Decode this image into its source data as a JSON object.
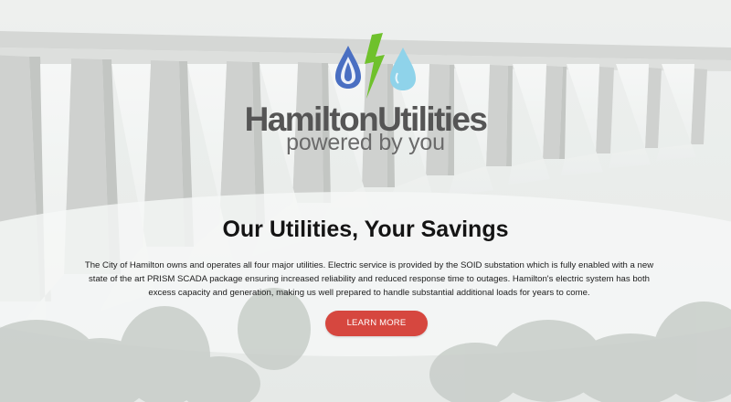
{
  "colors": {
    "water_drop_dark": "#4a6fc2",
    "bolt": "#6fc12c",
    "water_drop_light": "#8fd3ea",
    "logo_text": "#555555",
    "cta_background": "#d6473f",
    "cta_text": "#ffffff",
    "headline": "#141414"
  },
  "logo": {
    "name": "HamiltonUtilities",
    "tagline": "powered by you",
    "icons": [
      "water-drop-icon",
      "lightning-bolt-icon",
      "water-drop-icon"
    ]
  },
  "hero": {
    "background": "dam-spillway-photo",
    "headline": "Our Utilities, Your Savings",
    "paragraph": "The City of Hamilton owns and operates all four major utilities. Electric service is provided by the SOID substation which is fully enabled with a new state of the art PRISM SCADA package ensuring increased reliability and reduced response time to outages. Hamilton's electric system has both excess capacity and generation, making us well prepared to handle substantial additional loads for years to come.",
    "cta_label": "LEARN MORE"
  }
}
